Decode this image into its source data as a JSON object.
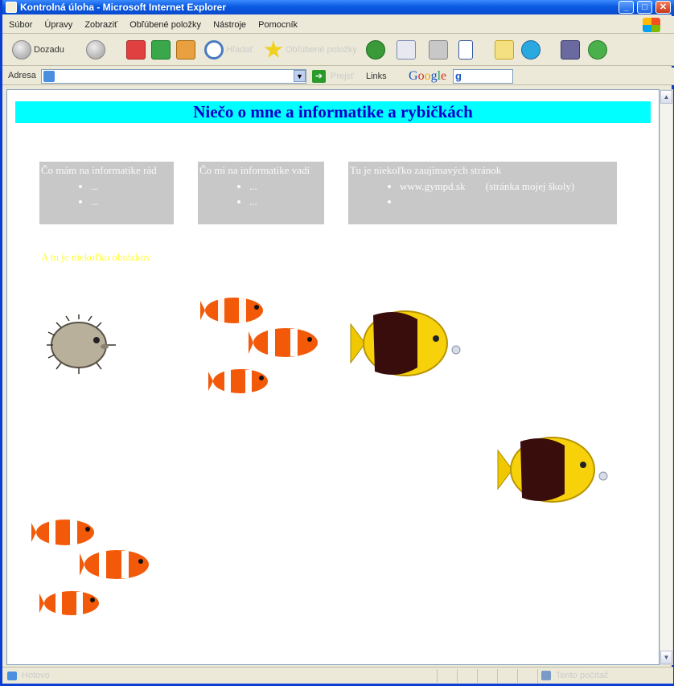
{
  "window": {
    "title": "Kontrolná úloha - Microsoft Internet Explorer",
    "buttons": {
      "minimize": "_",
      "maximize": "□",
      "close": "✕"
    }
  },
  "menubar": {
    "items": [
      "Súbor",
      "Úpravy",
      "Zobraziť",
      "Obľúbené položky",
      "Nástroje",
      "Pomocník"
    ]
  },
  "toolbar": {
    "back_label": "Dozadu",
    "search_label": "Hľadať",
    "favorites_label": "Obľúbené položky"
  },
  "addressbar": {
    "label": "Adresa",
    "value": "",
    "go_label": "Prejsť",
    "links_label": "Links",
    "google_logo": [
      "G",
      "o",
      "o",
      "g",
      "l",
      "e"
    ]
  },
  "page": {
    "header": "Niečo o mne a informatike a rybičkách",
    "boxes": [
      {
        "title": "Čo mám na informatike rád",
        "items": [
          "...",
          "..."
        ]
      },
      {
        "title": "Čo mi na informatike vadí",
        "items": [
          "...",
          "..."
        ]
      },
      {
        "title": "Tu je niekoľko zaujímavých stránok",
        "items": [
          {
            "link": "www.gympd.sk",
            "note": "(stránka mojej školy)"
          },
          {
            "link": "",
            "note": ""
          }
        ]
      }
    ],
    "images_label": "A tu je niekoľko obrázkov"
  },
  "statusbar": {
    "text": "Hotovo",
    "zone": "Tento počítač"
  },
  "colors": {
    "header_bg": "#00ffff",
    "header_text": "#0000cc",
    "box_bg": "#c8c8c8",
    "label": "#ffff33"
  },
  "icons": [
    "back-icon",
    "forward-icon",
    "stop-icon",
    "refresh-icon",
    "home-icon",
    "search-icon",
    "favorites-icon",
    "history-icon",
    "mail-icon",
    "print-icon",
    "word-icon",
    "note-icon",
    "skype-icon",
    "tools-icon",
    "messenger-icon"
  ]
}
